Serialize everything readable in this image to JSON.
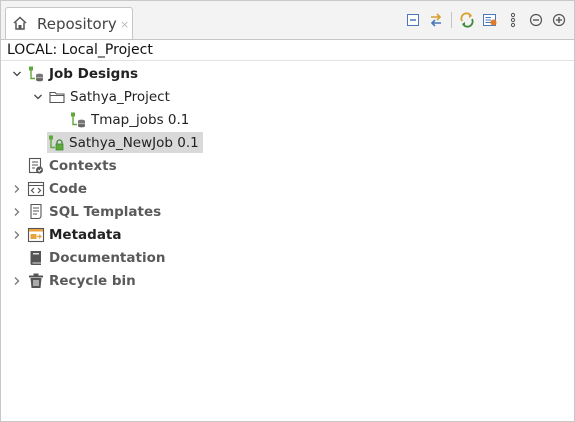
{
  "tab": {
    "label": "Repository",
    "close": "×"
  },
  "location": "LOCAL: Local_Project",
  "tree": {
    "job_designs": "Job Designs",
    "sathya_project": "Sathya_Project",
    "tmap_jobs": "Tmap_jobs 0.1",
    "sathya_newjob": "Sathya_NewJob 0.1",
    "contexts": "Contexts",
    "code": "Code",
    "sql_templates": "SQL Templates",
    "metadata": "Metadata",
    "documentation": "Documentation",
    "recycle_bin": "Recycle bin"
  },
  "selected_item": "Sathya_NewJob 0.1",
  "colors": {
    "job_green": "#5fa83a",
    "accent_orange": "#e8a33d",
    "selection": "#d9d9d9"
  }
}
